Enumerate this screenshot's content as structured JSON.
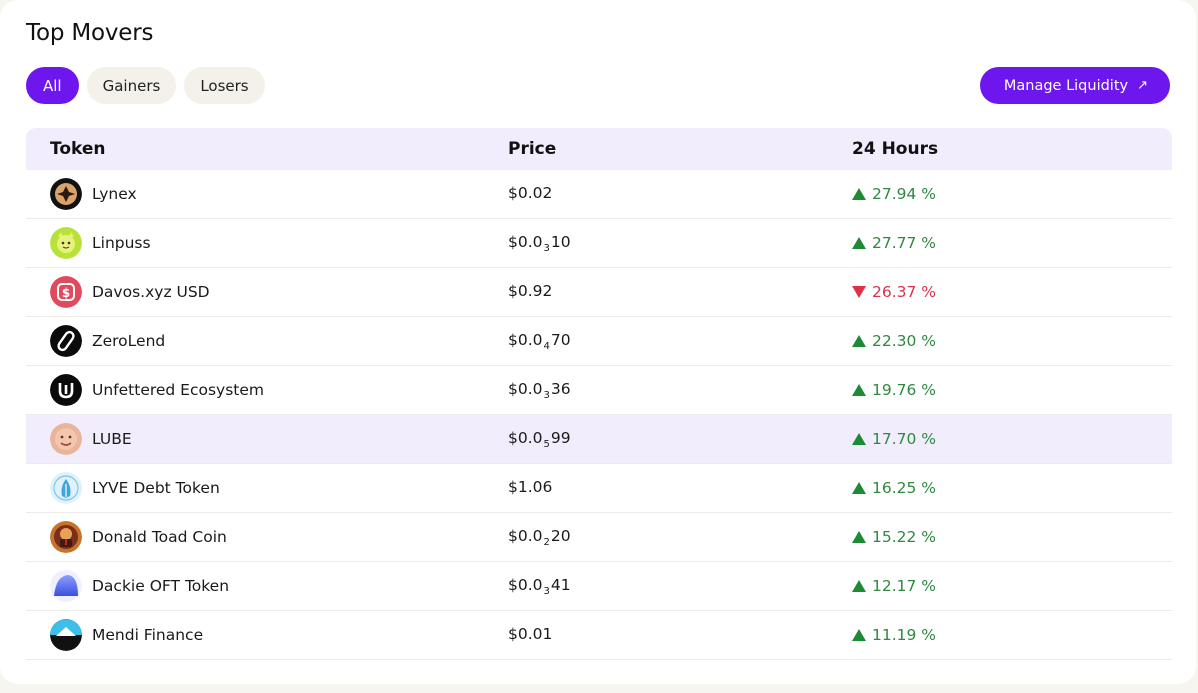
{
  "title": "Top Movers",
  "filters": [
    {
      "label": "All",
      "active": true
    },
    {
      "label": "Gainers",
      "active": false
    },
    {
      "label": "Losers",
      "active": false
    }
  ],
  "manage_button": {
    "label": "Manage Liquidity",
    "icon": "arrow-up-right-icon"
  },
  "table": {
    "headers": {
      "token": "Token",
      "price": "Price",
      "change": "24 Hours"
    },
    "rows": [
      {
        "name": "Lynex",
        "price_prefix": "$0.02",
        "price_sub": "",
        "price_suffix": "",
        "change": "27.94 %",
        "direction": "up",
        "icon": "lynex-logo-icon"
      },
      {
        "name": "Linpuss",
        "price_prefix": "$0.0",
        "price_sub": "3",
        "price_suffix": "10",
        "change": "27.77 %",
        "direction": "up",
        "icon": "linpuss-logo-icon"
      },
      {
        "name": "Davos.xyz USD",
        "price_prefix": "$0.92",
        "price_sub": "",
        "price_suffix": "",
        "change": "26.37 %",
        "direction": "down",
        "icon": "davos-logo-icon"
      },
      {
        "name": "ZeroLend",
        "price_prefix": "$0.0",
        "price_sub": "4",
        "price_suffix": "70",
        "change": "22.30 %",
        "direction": "up",
        "icon": "zerolend-logo-icon"
      },
      {
        "name": "Unfettered Ecosystem",
        "price_prefix": "$0.0",
        "price_sub": "3",
        "price_suffix": "36",
        "change": "19.76 %",
        "direction": "up",
        "icon": "unfettered-logo-icon"
      },
      {
        "name": "LUBE",
        "price_prefix": "$0.0",
        "price_sub": "5",
        "price_suffix": "99",
        "change": "17.70 %",
        "direction": "up",
        "icon": "lube-logo-icon",
        "highlighted": true
      },
      {
        "name": "LYVE Debt Token",
        "price_prefix": "$1.06",
        "price_sub": "",
        "price_suffix": "",
        "change": "16.25 %",
        "direction": "up",
        "icon": "lyve-logo-icon"
      },
      {
        "name": "Donald Toad Coin",
        "price_prefix": "$0.0",
        "price_sub": "2",
        "price_suffix": "20",
        "change": "15.22 %",
        "direction": "up",
        "icon": "donald-toad-logo-icon"
      },
      {
        "name": "Dackie OFT Token",
        "price_prefix": "$0.0",
        "price_sub": "3",
        "price_suffix": "41",
        "change": "12.17 %",
        "direction": "up",
        "icon": "dackie-logo-icon"
      },
      {
        "name": "Mendi Finance",
        "price_prefix": "$0.01",
        "price_sub": "",
        "price_suffix": "",
        "change": "11.19 %",
        "direction": "up",
        "icon": "mendi-logo-icon"
      }
    ]
  },
  "colors": {
    "accent": "#6d16ee",
    "up": "#2d8a3e",
    "down": "#d8344b",
    "header_bg": "#f1edfd",
    "pill_bg": "#f3f1ea"
  }
}
